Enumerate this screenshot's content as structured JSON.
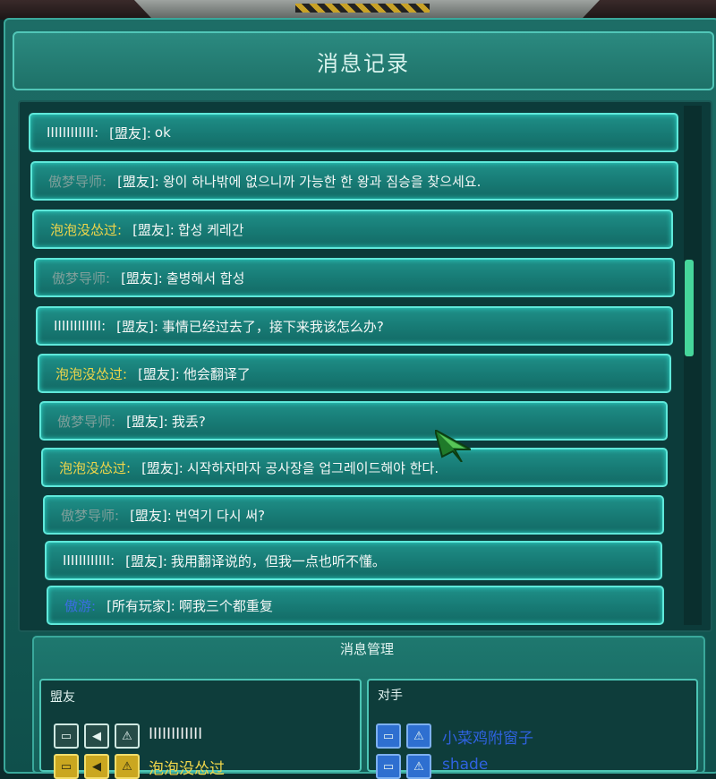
{
  "title": "消息记录",
  "messages": [
    {
      "sender": "IIIIIIIIIIII:",
      "sender_color": "plain",
      "channel": "[盟友]:",
      "text": "ok"
    },
    {
      "sender": "傲梦导师:",
      "sender_color": "gray",
      "channel": "[盟友]:",
      "text": "왕이 하나밖에 없으니까 가능한 한 왕과 짐승을 찾으세요."
    },
    {
      "sender": "泡泡没怂过:",
      "sender_color": "yellow",
      "channel": "[盟友]:",
      "text": "합성 케레간"
    },
    {
      "sender": "傲梦导师:",
      "sender_color": "gray",
      "channel": "[盟友]:",
      "text": "출병해서 합성"
    },
    {
      "sender": "IIIIIIIIIIII:",
      "sender_color": "plain",
      "channel": "[盟友]:",
      "text": "事情已经过去了，接下来我该怎么办?"
    },
    {
      "sender": "泡泡没怂过:",
      "sender_color": "yellow",
      "channel": "[盟友]:",
      "text": "他会翻译了"
    },
    {
      "sender": "傲梦导师:",
      "sender_color": "gray",
      "channel": "[盟友]:",
      "text": "我丢?"
    },
    {
      "sender": "泡泡没怂过:",
      "sender_color": "yellow",
      "channel": "[盟友]:",
      "text": "시작하자마자 공사장을 업그레이드해야 한다."
    },
    {
      "sender": "傲梦导师:",
      "sender_color": "gray",
      "channel": "[盟友]:",
      "text": "번역기 다시 써?"
    },
    {
      "sender": "IIIIIIIIIIII:",
      "sender_color": "plain",
      "channel": "[盟友]:",
      "text": "我用翻译说的，但我一点也听不懂。"
    },
    {
      "sender": "傲游:",
      "sender_color": "blue",
      "channel": "[所有玩家]:",
      "text": "啊我三个都重复"
    }
  ],
  "manager": {
    "title": "消息管理",
    "allies_title": "盟友",
    "opponents_title": "对手",
    "allies": [
      {
        "name": "IIIIIIIIIIII",
        "color": "#f2f2f2",
        "buttons": [
          "chat-icon",
          "speaker-icon",
          "warning-icon"
        ]
      },
      {
        "name": "泡泡没怂过",
        "color": "#f0d64a",
        "buttons": [
          "chat-icon",
          "speaker-icon",
          "warning-icon"
        ]
      }
    ],
    "opponents": [
      {
        "name": "小菜鸡附窗子",
        "color": "#2f62e0",
        "buttons": [
          "chat-icon",
          "warning-icon"
        ]
      },
      {
        "name": "shade",
        "color": "#2f62e0",
        "buttons": [
          "chat-icon",
          "warning-icon"
        ]
      }
    ]
  }
}
